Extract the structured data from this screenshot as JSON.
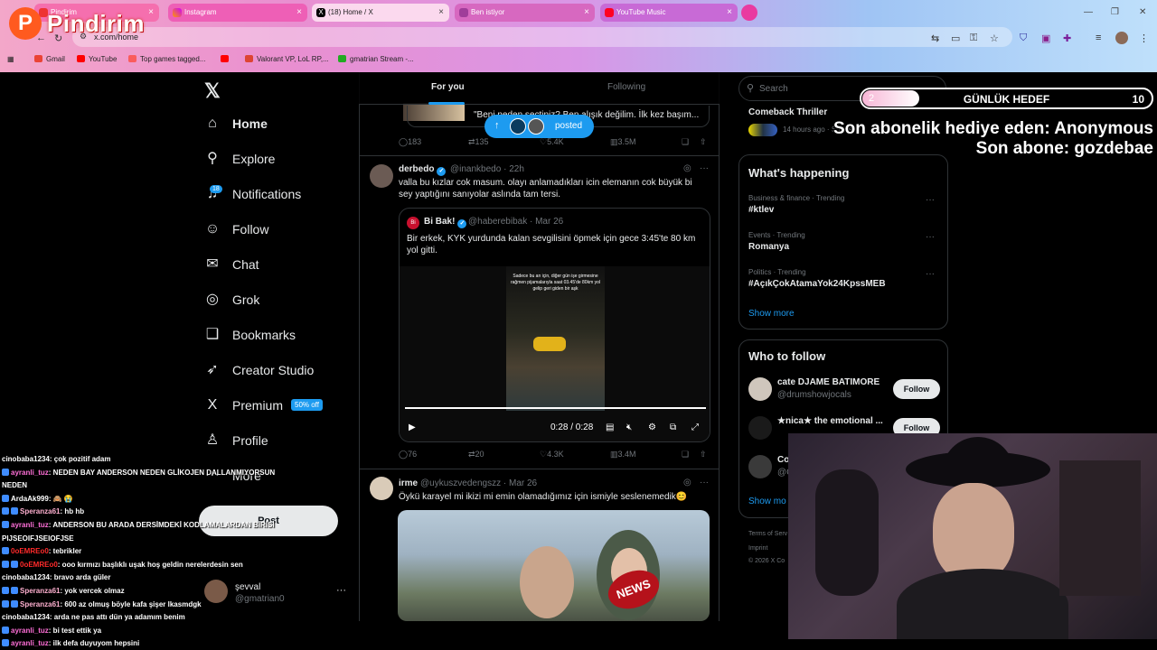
{
  "browser": {
    "tabs": [
      {
        "label": "Pindirim",
        "active": false
      },
      {
        "label": "Instagram",
        "active": false
      },
      {
        "label": "(18) Home / X",
        "active": true
      },
      {
        "label": "Ben istiyor",
        "active": false
      },
      {
        "label": "YouTube Music",
        "active": false
      }
    ],
    "url": "x.com/home",
    "bookmarks": [
      "Gmail",
      "YouTube",
      "Top games tagged...",
      "",
      "Valorant VP, LoL RP,...",
      "gmatrian Stream -..."
    ]
  },
  "overlay_logo": "Pindirim",
  "nav": {
    "items": [
      {
        "label": "Home",
        "icon": "home-icon",
        "glyph": "⌂",
        "bold": true
      },
      {
        "label": "Explore",
        "icon": "search-icon",
        "glyph": "⚲"
      },
      {
        "label": "Notifications",
        "icon": "bell-icon",
        "glyph": "♫"
      },
      {
        "label": "Follow",
        "icon": "add-person-icon",
        "glyph": "☺"
      },
      {
        "label": "Chat",
        "icon": "mail-icon",
        "glyph": "✉"
      },
      {
        "label": "Grok",
        "icon": "grok-icon",
        "glyph": "◎"
      },
      {
        "label": "Bookmarks",
        "icon": "bookmark-icon",
        "glyph": "❑"
      },
      {
        "label": "Creator Studio",
        "icon": "rocket-icon",
        "glyph": "➶"
      },
      {
        "label": "Premium",
        "icon": "x-logo-icon",
        "glyph": "X"
      },
      {
        "label": "Profile",
        "icon": "person-icon",
        "glyph": "♙"
      },
      {
        "label": "More",
        "icon": "more-circle-icon",
        "glyph": "⋯"
      }
    ],
    "notif_badge": "18",
    "premium_tag": "50% off",
    "post_label": "Post",
    "account": {
      "name": "şevval",
      "handle": "@gmatrian0"
    }
  },
  "feed": {
    "tabs": [
      "For you",
      "Following"
    ],
    "posted_label": "posted",
    "top_tweet": {
      "quote_snippet": "\"Beni neden seçtiniz? Ben alışık değilim. İlk kez başım...",
      "replies": "183",
      "reposts": "135",
      "likes": "5.4K",
      "views": "3.5M"
    },
    "tweet1": {
      "name": "derbedo",
      "handle": "@inankbedo",
      "time": "· 22h",
      "text": "valla bu kızlar cok masum. olayı anlamadıkları icin elemanın cok büyük bi sey yaptığını sanıyolar aslında tam tersi.",
      "quote": {
        "name": "Bi Bak!",
        "handle": "@haberebibak",
        "time": "· Mar 26",
        "text": "Bir erkek, KYK yurdunda kalan sevgilisini öpmek için gece 3:45'te 80 km yol gitti.",
        "video_caption": "Sadece bu an için, diğer gün işe girmesine rağmen pijamalarıyla saat 03.45'de 80km yol gelip geri giden bir aşk",
        "video_time": "0:28 / 0:28"
      },
      "replies": "76",
      "reposts": "20",
      "likes": "4.3K",
      "views": "3.4M"
    },
    "tweet2": {
      "name": "irme",
      "handle": "@uykuszvedengszz",
      "time": "· Mar 26",
      "text": "Öykü karayel mi ikizi mi emin olamadığımız için ismiyle seslenemedik😊",
      "image_badge": "NEWS"
    }
  },
  "sidebar": {
    "search_placeholder": "Search",
    "sports": {
      "title": "Comeback Thriller",
      "meta": "14 hours ago · Sports"
    },
    "happening": {
      "title": "What's happening",
      "trends": [
        {
          "category": "Business & finance · Trending",
          "name": "#ktlev"
        },
        {
          "category": "Events · Trending",
          "name": "Romanya"
        },
        {
          "category": "Politics · Trending",
          "name": "#AçıkÇokAtamaYok24KpssMEB"
        }
      ],
      "show_more": "Show more"
    },
    "who_to_follow": {
      "title": "Who to follow",
      "users": [
        {
          "name": "cate DJAME BATIMORE",
          "handle": "@drumshowjocals"
        },
        {
          "name": "★nica★ the emotional ...",
          "handle": "@C..."
        },
        {
          "name": "Co",
          "handle": "@C"
        }
      ],
      "follow_label": "Follow",
      "show_more": "Show mo"
    },
    "footer": [
      "Terms of Serv",
      "Imprint",
      "© 2026 X Co"
    ]
  },
  "stream": {
    "goal": {
      "current": "2",
      "label": "GÜNLÜK HEDEF",
      "target": "10",
      "progress": 0.2
    },
    "gift_line": "Son abonelik hediye eden: Anonymous",
    "sub_line": "Son abone: gozdebae"
  },
  "chat": [
    {
      "user": "cinobaba1234",
      "msg": ": çok pozitif adam",
      "color": "u1",
      "icons": 0
    },
    {
      "user": "ayranli_tuz",
      "msg": ": NEDEN BAY ANDERSON NEDEN GLİKOJEN DALLANMIYORSUN",
      "color": "u2",
      "icons": 1
    },
    {
      "user": "",
      "msg": "NEDEN",
      "color": "u1",
      "icons": 0
    },
    {
      "user": "ArdaAk999",
      "msg": ": 🙈 😭",
      "color": "u1",
      "icons": 1
    },
    {
      "user": "Speranza61",
      "msg": ": hb hb",
      "color": "u3",
      "icons": 2
    },
    {
      "user": "ayranli_tuz",
      "msg": ": ANDERSON BU ARADA DERSİMDEKİ KODLAMALARDAN BİRİSİ",
      "color": "u2",
      "icons": 1
    },
    {
      "user": "",
      "msg": "PIJSEOIFJSEIOFJSE",
      "color": "u1",
      "icons": 0
    },
    {
      "user": "0oEMREo0",
      "msg": ": tebrikler",
      "color": "u4",
      "icons": 1
    },
    {
      "user": "0oEMREo0",
      "msg": ": ooo kırmızı başlıklı uşak hoş geldin nerelerdesin sen",
      "color": "u4",
      "icons": 2
    },
    {
      "user": "cinobaba1234",
      "msg": ": bravo arda güler",
      "color": "u1",
      "icons": 0
    },
    {
      "user": "Speranza61",
      "msg": ": yok vercek olmaz",
      "color": "u3",
      "icons": 2
    },
    {
      "user": "Speranza61",
      "msg": ": 600 az olmuş böyle kafa şişer lkasmdgk",
      "color": "u3",
      "icons": 2
    },
    {
      "user": "cinobaba1234",
      "msg": ": arda ne pas attı dün ya adamım benim",
      "color": "u1",
      "icons": 0
    },
    {
      "user": "ayranli_tuz",
      "msg": ": bi test ettik ya",
      "color": "u2",
      "icons": 1
    },
    {
      "user": "ayranli_tuz",
      "msg": ": ilk defa duyuyom hepsini",
      "color": "u2",
      "icons": 1
    }
  ],
  "colors": {
    "accent": "#1d9bf0",
    "background": "#000000",
    "text": "#e7e9ea",
    "muted": "#71767b"
  }
}
